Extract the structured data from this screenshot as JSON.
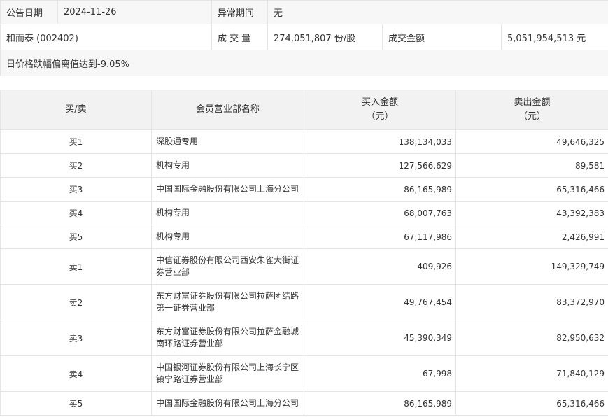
{
  "info": {
    "announce_date_label": "公告日期",
    "announce_date_value": "2024-11-26",
    "abnormal_period_label": "异常期间",
    "abnormal_period_value": "无",
    "stock": "和而泰 (002402)",
    "volume_label": "成 交 量",
    "volume_value": "274,051,807 份/股",
    "amount_label": "成交金额",
    "amount_value": "5,051,954,513 元",
    "reason": "日价格跌幅偏离值达到-9.05%"
  },
  "table": {
    "headers": {
      "side": "买/卖",
      "dept": "会员营业部名称",
      "buy": "买入金额",
      "buy_unit": "（元）",
      "sell": "卖出金额",
      "sell_unit": "（元）"
    },
    "rows": [
      {
        "side": "买1",
        "dept": "深股通专用",
        "buy": "138,134,033",
        "sell": "49,646,325"
      },
      {
        "side": "买2",
        "dept": "机构专用",
        "buy": "127,566,629",
        "sell": "89,581"
      },
      {
        "side": "买3",
        "dept": "中国国际金融股份有限公司上海分公司",
        "buy": "86,165,989",
        "sell": "65,316,466"
      },
      {
        "side": "买4",
        "dept": "机构专用",
        "buy": "68,007,763",
        "sell": "43,392,383"
      },
      {
        "side": "买5",
        "dept": "机构专用",
        "buy": "67,117,986",
        "sell": "2,426,991"
      },
      {
        "side": "卖1",
        "dept": "中信证券股份有限公司西安朱雀大街证券营业部",
        "buy": "409,926",
        "sell": "149,329,749"
      },
      {
        "side": "卖2",
        "dept": "东方财富证券股份有限公司拉萨团结路第一证券营业部",
        "buy": "49,767,454",
        "sell": "83,372,970"
      },
      {
        "side": "卖3",
        "dept": "东方财富证券股份有限公司拉萨金融城南环路证券营业部",
        "buy": "45,390,349",
        "sell": "82,950,632"
      },
      {
        "side": "卖4",
        "dept": "中国银河证券股份有限公司上海长宁区镇宁路证券营业部",
        "buy": "67,998",
        "sell": "71,840,129"
      },
      {
        "side": "卖5",
        "dept": "中国国际金融股份有限公司上海分公司",
        "buy": "86,165,989",
        "sell": "65,316,466"
      }
    ]
  }
}
